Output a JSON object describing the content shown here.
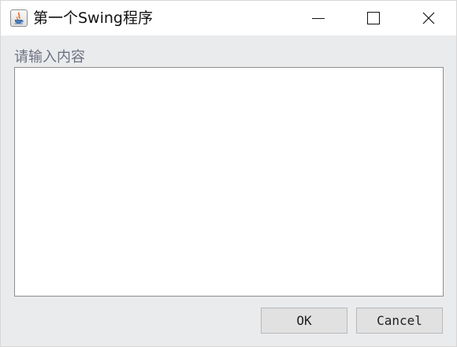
{
  "window": {
    "title": "第一个Swing程序",
    "controls": {
      "minimize_icon": "minimize-icon",
      "maximize_icon": "maximize-icon",
      "close_icon": "close-icon"
    }
  },
  "form": {
    "label": "请输入内容",
    "text_value": "",
    "ok_label": "OK",
    "cancel_label": "Cancel"
  },
  "colors": {
    "titlebar": "#ffffff",
    "content_background": "#eaebed",
    "label_text": "#6d7180",
    "text_area": "#ffffff",
    "button_background": "#e1e1e1",
    "button_border": "#b9b9b9"
  },
  "icons": {
    "app": "java-coffee-cup-icon"
  }
}
